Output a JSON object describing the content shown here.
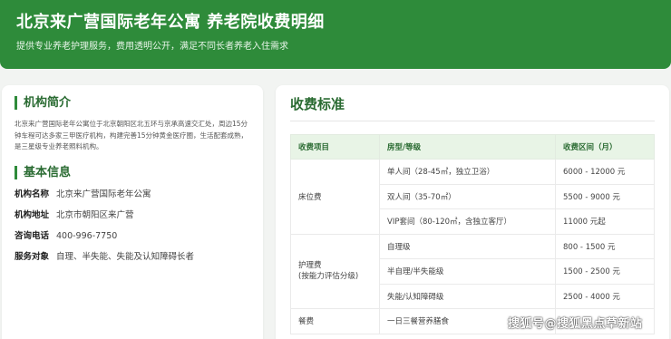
{
  "header": {
    "title": "北京来广营国际老年公寓 养老院收费明细",
    "subtitle": "提供专业养老护理服务，费用透明公开，满足不同长者养老入住需求"
  },
  "intro": {
    "title": "机构简介",
    "text": "北京来广营国际老年公寓位于北京朝阳区北五环与京承高速交汇处，周边15分钟车程可达多家三甲医疗机构，构建完善15分钟黄金医疗圈，生活配套成熟，是三星级专业养老照料机构。"
  },
  "basic_info": {
    "title": "基本信息",
    "rows": [
      {
        "key": "机构名称",
        "value": "北京来广营国际老年公寓"
      },
      {
        "key": "机构地址",
        "value": "北京市朝阳区来广营"
      },
      {
        "key": "咨询电话",
        "value": "400-996-7750"
      },
      {
        "key": "服务对象",
        "value": "自理、半失能、失能及认知障碍长者"
      }
    ]
  },
  "fees": {
    "title": "收费标准",
    "headers": [
      "收费项目",
      "房型/等级",
      "收费区间（月）"
    ],
    "groups": [
      {
        "category": "床位费",
        "rows": [
          {
            "type": "单人间（28-45㎡，独立卫浴）",
            "price": "6000 - 12000 元"
          },
          {
            "type": "双人间（35-70㎡）",
            "price": "5500 - 9000 元"
          },
          {
            "type": "VIP套间（80-120㎡，含独立客厅）",
            "price": "11000 元起"
          }
        ]
      },
      {
        "category": "护理费\n(按能力评估分级)",
        "rows": [
          {
            "type": "自理级",
            "price": "800 - 1500 元"
          },
          {
            "type": "半自理/半失能级",
            "price": "1500 - 2500 元"
          },
          {
            "type": "失能/认知障碍级",
            "price": "2500 - 4000 元"
          }
        ]
      },
      {
        "category": "餐费",
        "rows": [
          {
            "type": "一日三餐营养膳食",
            "price": ""
          }
        ]
      }
    ]
  },
  "watermark": "搜狐号@搜狐黑点草新站"
}
